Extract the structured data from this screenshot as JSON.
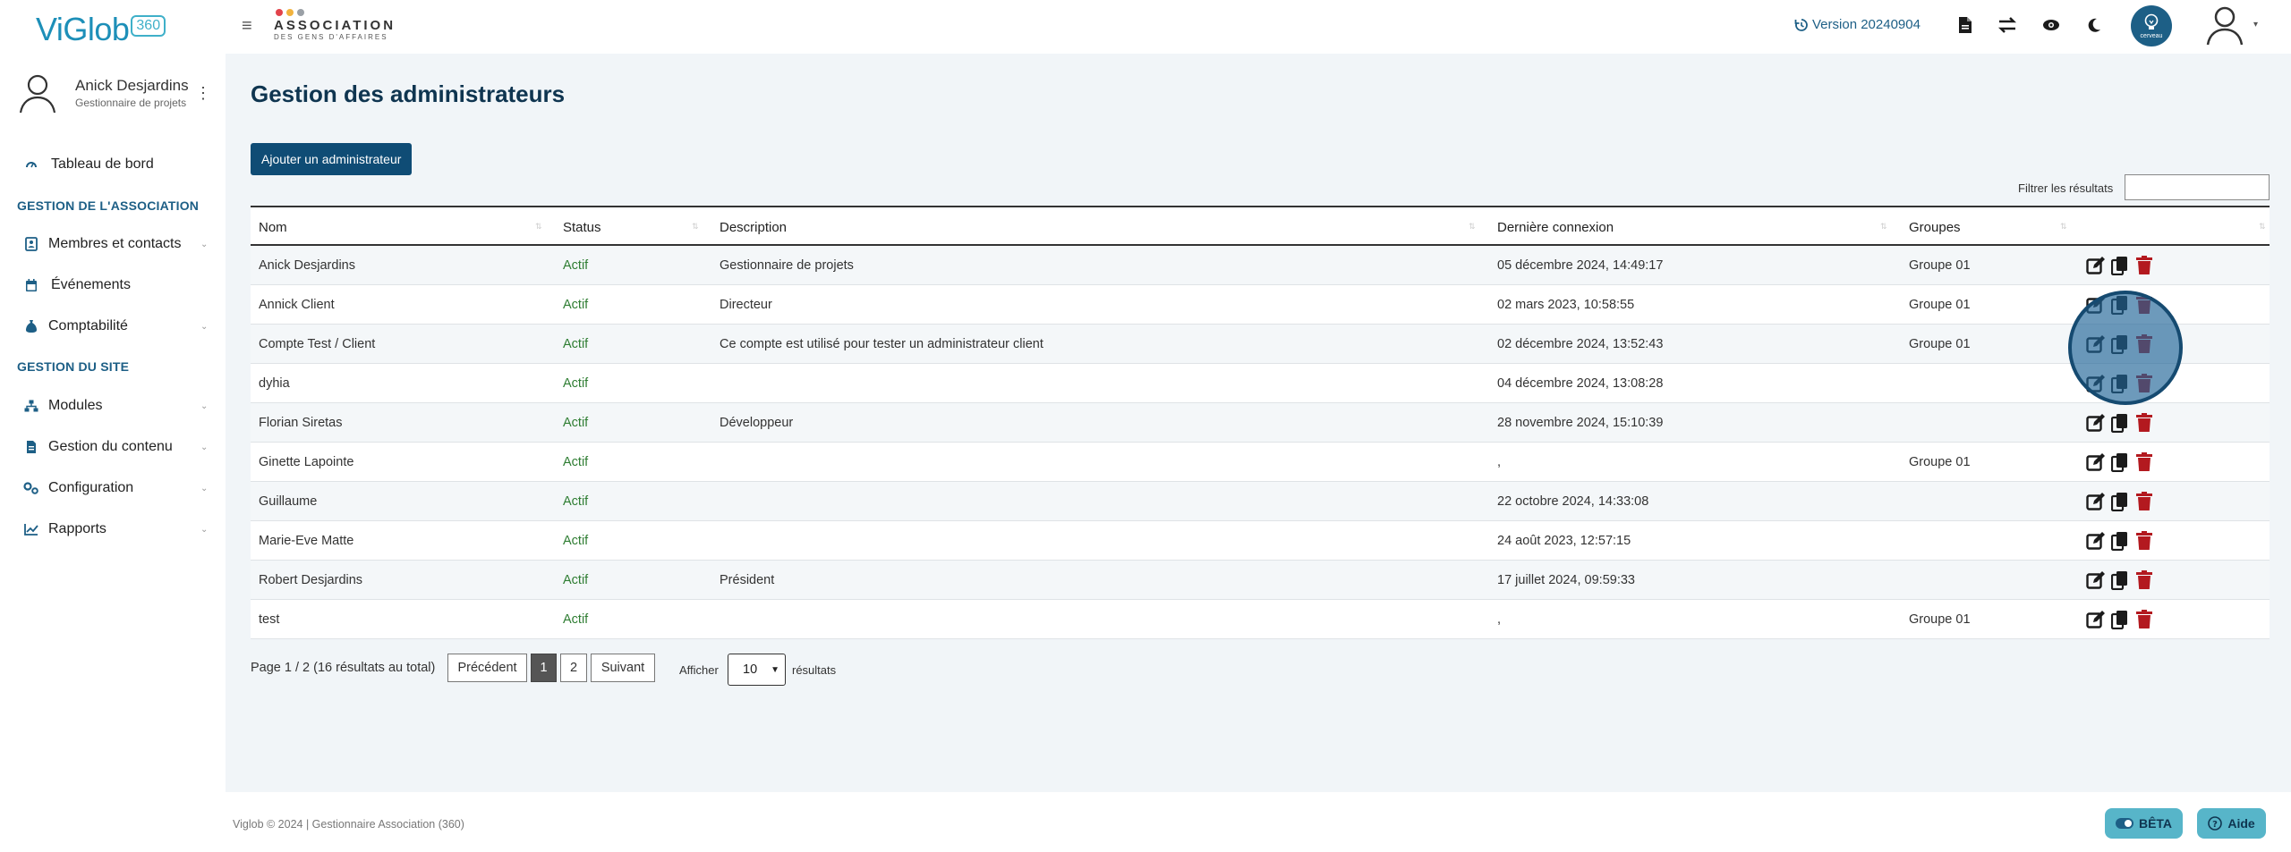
{
  "brand": {
    "logo_text": "ViGlob",
    "logo_badge": "360",
    "association_name": "ASSOCIATION",
    "association_sub": "DES GENS D'AFFAIRES",
    "accent": "#1d5f86",
    "dot_colors": [
      "#e2434b",
      "#f2b33d",
      "#9aa0a6"
    ]
  },
  "topbar": {
    "version": "Version 20240904",
    "cerveau_label": "cerveau"
  },
  "profile": {
    "name": "Anick Desjardins",
    "role": "Gestionnaire de projets"
  },
  "sidebar": {
    "dashboard": "Tableau de bord",
    "section_association": "GESTION DE L'ASSOCIATION",
    "members": "Membres et contacts",
    "events": "Événements",
    "accounting": "Comptabilité",
    "section_site": "GESTION DU SITE",
    "modules": "Modules",
    "content": "Gestion du contenu",
    "configuration": "Configuration",
    "reports": "Rapports"
  },
  "page": {
    "title": "Gestion des administrateurs",
    "add_button": "Ajouter un administrateur",
    "filter_label": "Filtrer les résultats",
    "filter_value": ""
  },
  "table": {
    "headers": {
      "name": "Nom",
      "status": "Status",
      "description": "Description",
      "last_login": "Dernière connexion",
      "groups": "Groupes"
    },
    "rows": [
      {
        "name": "Anick Desjardins",
        "status": "Actif",
        "description": "Gestionnaire de projets",
        "last_login": "05 décembre 2024, 14:49:17",
        "groups": "Groupe 01"
      },
      {
        "name": "Annick Client",
        "status": "Actif",
        "description": "Directeur",
        "last_login": "02 mars 2023, 10:58:55",
        "groups": "Groupe 01"
      },
      {
        "name": "Compte Test / Client",
        "status": "Actif",
        "description": "Ce compte est utilisé pour tester un administrateur client",
        "last_login": "02 décembre 2024, 13:52:43",
        "groups": "Groupe 01"
      },
      {
        "name": "dyhia",
        "status": "Actif",
        "description": "",
        "last_login": "04 décembre 2024, 13:08:28",
        "groups": ""
      },
      {
        "name": "Florian Siretas",
        "status": "Actif",
        "description": "Développeur",
        "last_login": "28 novembre 2024, 15:10:39",
        "groups": ""
      },
      {
        "name": "Ginette Lapointe",
        "status": "Actif",
        "description": "",
        "last_login": ",",
        "groups": "Groupe 01"
      },
      {
        "name": "Guillaume",
        "status": "Actif",
        "description": "",
        "last_login": "22 octobre 2024, 14:33:08",
        "groups": ""
      },
      {
        "name": "Marie-Eve Matte",
        "status": "Actif",
        "description": "",
        "last_login": "24 août 2023, 12:57:15",
        "groups": ""
      },
      {
        "name": "Robert Desjardins",
        "status": "Actif",
        "description": "Président",
        "last_login": "17 juillet 2024, 09:59:33",
        "groups": ""
      },
      {
        "name": "test",
        "status": "Actif",
        "description": "",
        "last_login": ",",
        "groups": "Groupe 01"
      }
    ]
  },
  "pagination": {
    "info": "Page 1 / 2 (16 résultats au total)",
    "prev": "Précédent",
    "page1": "1",
    "page2": "2",
    "next": "Suivant",
    "show_label": "Afficher",
    "page_size": "10",
    "results_label": "résultats"
  },
  "footer": {
    "text": "Viglob © 2024 | Gestionnaire Association (360)",
    "beta": "BÊTA",
    "help": "Aide"
  }
}
